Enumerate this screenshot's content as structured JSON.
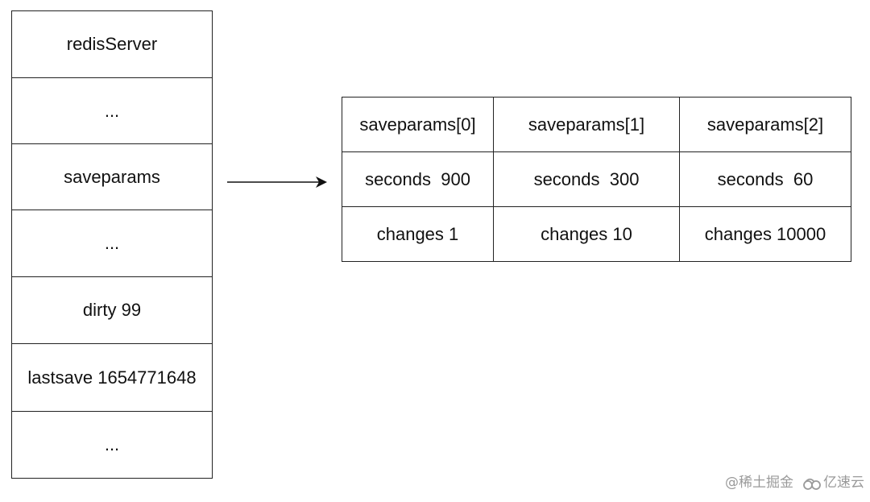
{
  "left_struct": {
    "cells": [
      "redisServer",
      "...",
      "saveparams",
      "...",
      "dirty 99",
      "lastsave 1654771648",
      "..."
    ]
  },
  "arrow": {
    "from": "saveparams",
    "to": "saveparams-array"
  },
  "saveparams_table": {
    "headers": [
      "saveparams[0]",
      "saveparams[1]",
      "saveparams[2]"
    ],
    "rows": [
      [
        "seconds  900",
        "seconds  300",
        "seconds  60"
      ],
      [
        "changes 1",
        "changes 10",
        "changes 10000"
      ]
    ]
  },
  "watermarks": {
    "juejin": "@稀土掘金",
    "yisu": "亿速云",
    "yisu_icon": "cloud-icon"
  }
}
